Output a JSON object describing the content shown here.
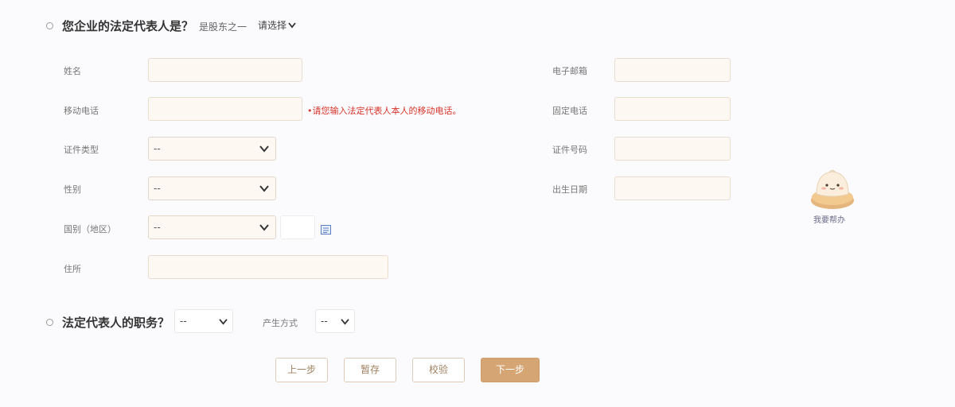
{
  "section1": {
    "title": "您企业的法定代表人是？",
    "sub_label": "是股东之一",
    "select_value": "请选择"
  },
  "left_fields": [
    {
      "label": "姓名"
    },
    {
      "label": "移动电话"
    },
    {
      "label": "证件类型",
      "value": "--"
    },
    {
      "label": "性别",
      "value": "--"
    },
    {
      "label": "国别（地区）",
      "value": "--"
    },
    {
      "label": "住所"
    }
  ],
  "mobile_hint": "•请您输入法定代表人本人的移动电话。",
  "right_fields": [
    {
      "label": "电子邮箱"
    },
    {
      "label": "固定电话"
    },
    {
      "label": "证件号码"
    },
    {
      "label": "出生日期"
    }
  ],
  "helper": {
    "label": "我要帮办",
    "icon": "bun-mascot-icon"
  },
  "section2": {
    "title": "法定代表人的职务？",
    "duty_value": "--",
    "method_label": "产生方式",
    "method_value": "--"
  },
  "buttons": {
    "prev": "上一步",
    "save": "暂存",
    "check": "校验",
    "next": "下一步"
  },
  "colors": {
    "accent": "#d6a574",
    "input_bg": "#fdf8f2",
    "hint": "#d9342b"
  }
}
